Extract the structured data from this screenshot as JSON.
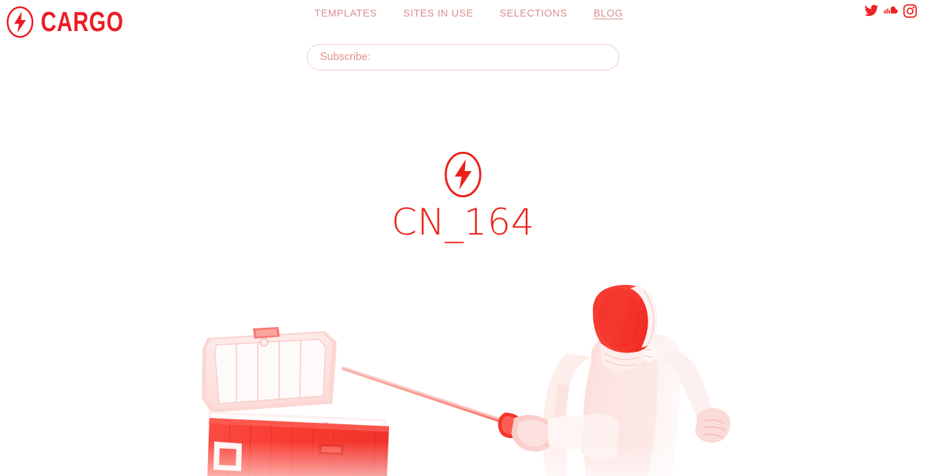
{
  "header": {
    "brand": {
      "name": "CARGO",
      "icon": "lightning-bolt-oval-icon"
    },
    "nav": [
      {
        "label": "TEMPLATES",
        "active": false
      },
      {
        "label": "SITES IN USE",
        "active": false
      },
      {
        "label": "SELECTIONS",
        "active": false
      },
      {
        "label": "BLOG",
        "active": true
      }
    ],
    "social": [
      {
        "name": "twitter-icon",
        "label": "Twitter"
      },
      {
        "name": "soundcloud-icon",
        "label": "SoundCloud"
      },
      {
        "name": "instagram-icon",
        "label": "Instagram"
      }
    ]
  },
  "subscribe": {
    "placeholder": "Subscribe:",
    "value": ""
  },
  "post": {
    "mark_icon": "lightning-bolt-oval-icon",
    "title": "CN_164"
  },
  "artwork": {
    "alt": "Red-tinted photo of an open cooler box and a fencer in uniform with a red mask holding a sword",
    "elements": [
      "open-cooler-box",
      "fencing-sword",
      "fencer-figure",
      "fencing-mask"
    ]
  },
  "colors": {
    "brand_red": "#ec1c24",
    "title_red": "#ec2119",
    "nav_rose": "#dc8e8e",
    "input_border": "#f3c8c8",
    "placeholder": "#e2908f",
    "background": "#ffffff"
  }
}
